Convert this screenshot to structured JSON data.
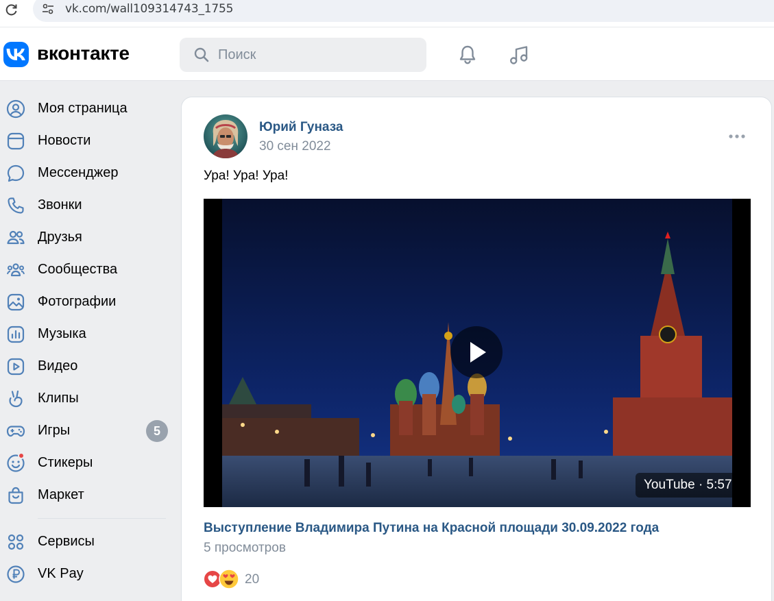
{
  "browser": {
    "url": "vk.com/wall109314743_1755"
  },
  "header": {
    "logo_text": "вконтакте",
    "search_placeholder": "Поиск",
    "icons": [
      "bell-icon",
      "music-icon"
    ]
  },
  "sidebar": {
    "items": [
      {
        "label": "Моя страница",
        "icon": "user-circle-icon"
      },
      {
        "label": "Новости",
        "icon": "news-icon"
      },
      {
        "label": "Мессенджер",
        "icon": "message-bubble-icon"
      },
      {
        "label": "Звонки",
        "icon": "phone-icon"
      },
      {
        "label": "Друзья",
        "icon": "friends-icon"
      },
      {
        "label": "Сообщества",
        "icon": "communities-icon"
      },
      {
        "label": "Фотографии",
        "icon": "photos-icon"
      },
      {
        "label": "Музыка",
        "icon": "music-bars-icon"
      },
      {
        "label": "Видео",
        "icon": "video-play-icon"
      },
      {
        "label": "Клипы",
        "icon": "clips-icon"
      },
      {
        "label": "Игры",
        "icon": "gamepad-icon",
        "badge": "5"
      },
      {
        "label": "Стикеры",
        "icon": "sticker-icon"
      },
      {
        "label": "Маркет",
        "icon": "shopping-bag-icon"
      }
    ],
    "secondary": [
      {
        "label": "Сервисы",
        "icon": "services-grid-icon"
      },
      {
        "label": "VK Pay",
        "icon": "vk-pay-icon"
      }
    ]
  },
  "post": {
    "author": "Юрий Гуназа",
    "date": "30 сен 2022",
    "text": "Ура! Ура! Ура!",
    "video": {
      "source_duration": "YouTube · 5:57",
      "title": "Выступление Владимира Путина на Красной площади 30.09.2022 года",
      "views": "5 просмотров"
    },
    "reactions_count": "20"
  },
  "colors": {
    "brand": "#0077ff",
    "link": "#2a5885",
    "secondary_text": "#818c99",
    "badge": "#99a2ad",
    "background": "#edeef0"
  }
}
